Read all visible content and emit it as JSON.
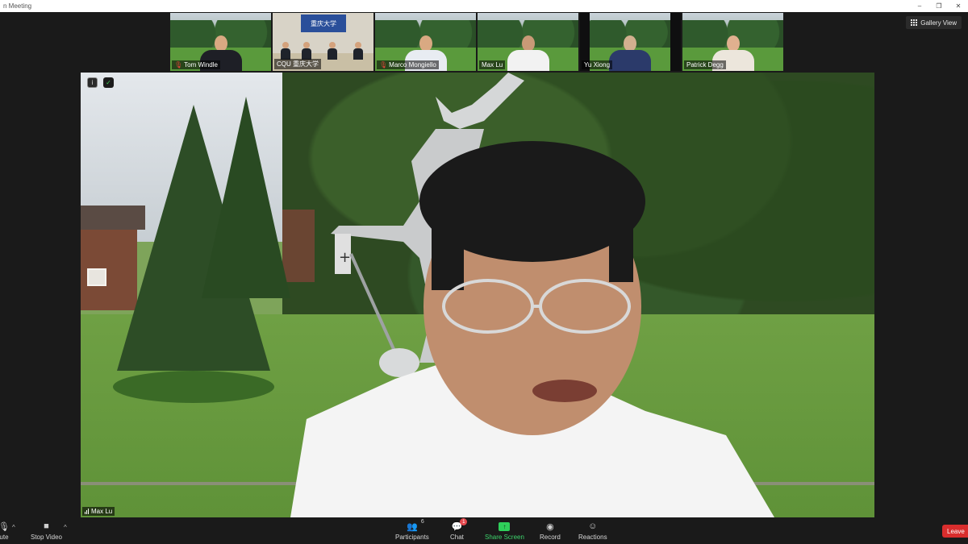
{
  "window": {
    "title": "n Meeting",
    "controls": [
      "–",
      "❐",
      "✕"
    ]
  },
  "view_button": {
    "label": "Gallery View"
  },
  "participants_strip": [
    {
      "name": "Tom Windle",
      "muted": true
    },
    {
      "name": "CQU 重庆大学",
      "muted": false,
      "banner": "重庆大学"
    },
    {
      "name": "Marco Mongiello",
      "muted": true
    },
    {
      "name": "Max Lu",
      "muted": false,
      "active": true
    },
    {
      "name": "Yu Xiong",
      "muted": false
    },
    {
      "name": "Patrick Degg",
      "muted": false
    }
  ],
  "main_video": {
    "speaker_name": "Max Lu",
    "info_icon": "i",
    "shield_icon": "✓"
  },
  "toolbar": {
    "mute_label": "ute",
    "stop_video_label": "Stop Video",
    "participants_label": "Participants",
    "participants_count": "6",
    "chat_label": "Chat",
    "chat_badge": "1",
    "share_screen_label": "Share Screen",
    "record_label": "Record",
    "reactions_label": "Reactions",
    "leave_label": "Leave",
    "caret": "^"
  },
  "colors": {
    "share_green": "#2fcf5a",
    "leave_red": "#d92d2d",
    "active_speaker_outline": "#7ad66a"
  }
}
